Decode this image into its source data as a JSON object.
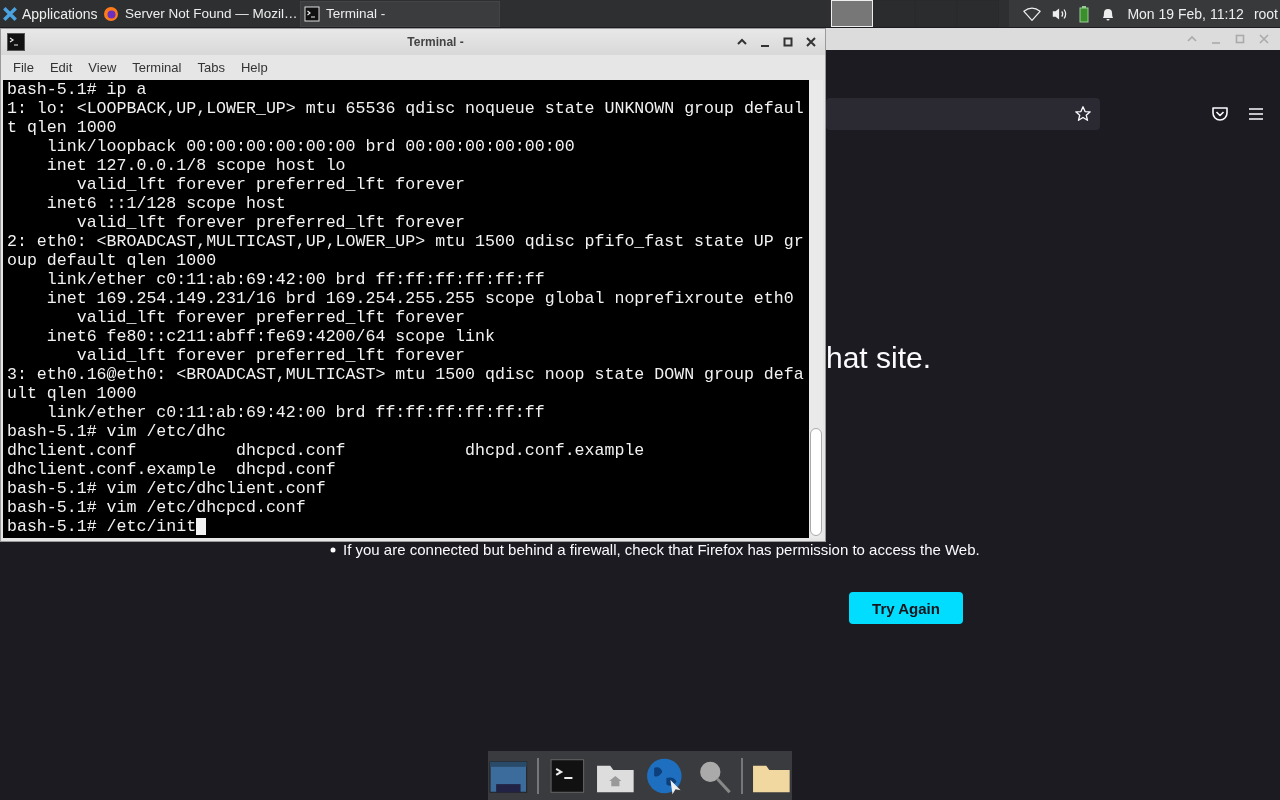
{
  "top_panel": {
    "app_menu": "Applications",
    "tasks": [
      {
        "label": "Server Not Found — Mozil…",
        "selected": false
      },
      {
        "label": "Terminal -",
        "selected": true
      }
    ],
    "workspaces": [
      {
        "selected": true
      },
      {
        "selected": false
      },
      {
        "selected": false
      },
      {
        "selected": false
      }
    ],
    "clock": "Mon 19 Feb, 11:12",
    "user": "root"
  },
  "browser": {
    "heading": "hat site.",
    "bullets": [
      "If you are connected but behind a firewall, check that Firefox has permission to access the Web."
    ],
    "button": "Try Again"
  },
  "terminal": {
    "title": "Terminal -",
    "menu": [
      "File",
      "Edit",
      "View",
      "Terminal",
      "Tabs",
      "Help"
    ],
    "lines": [
      "bash-5.1# ip a",
      "1: lo: <LOOPBACK,UP,LOWER_UP> mtu 65536 qdisc noqueue state UNKNOWN group defaul",
      "t qlen 1000",
      "    link/loopback 00:00:00:00:00:00 brd 00:00:00:00:00:00",
      "    inet 127.0.0.1/8 scope host lo",
      "       valid_lft forever preferred_lft forever",
      "    inet6 ::1/128 scope host",
      "       valid_lft forever preferred_lft forever",
      "2: eth0: <BROADCAST,MULTICAST,UP,LOWER_UP> mtu 1500 qdisc pfifo_fast state UP gr",
      "oup default qlen 1000",
      "    link/ether c0:11:ab:69:42:00 brd ff:ff:ff:ff:ff:ff",
      "    inet 169.254.149.231/16 brd 169.254.255.255 scope global noprefixroute eth0",
      "       valid_lft forever preferred_lft forever",
      "    inet6 fe80::c211:abff:fe69:4200/64 scope link",
      "       valid_lft forever preferred_lft forever",
      "3: eth0.16@eth0: <BROADCAST,MULTICAST> mtu 1500 qdisc noop state DOWN group defa",
      "ult qlen 1000",
      "    link/ether c0:11:ab:69:42:00 brd ff:ff:ff:ff:ff:ff",
      "bash-5.1# vim /etc/dhc",
      "dhclient.conf          dhcpcd.conf            dhcpd.conf.example",
      "dhclient.conf.example  dhcpd.conf",
      "bash-5.1# vim /etc/dhclient.conf",
      "bash-5.1# vim /etc/dhcpcd.conf",
      "bash-5.1# /etc/init"
    ],
    "cursor": true
  }
}
